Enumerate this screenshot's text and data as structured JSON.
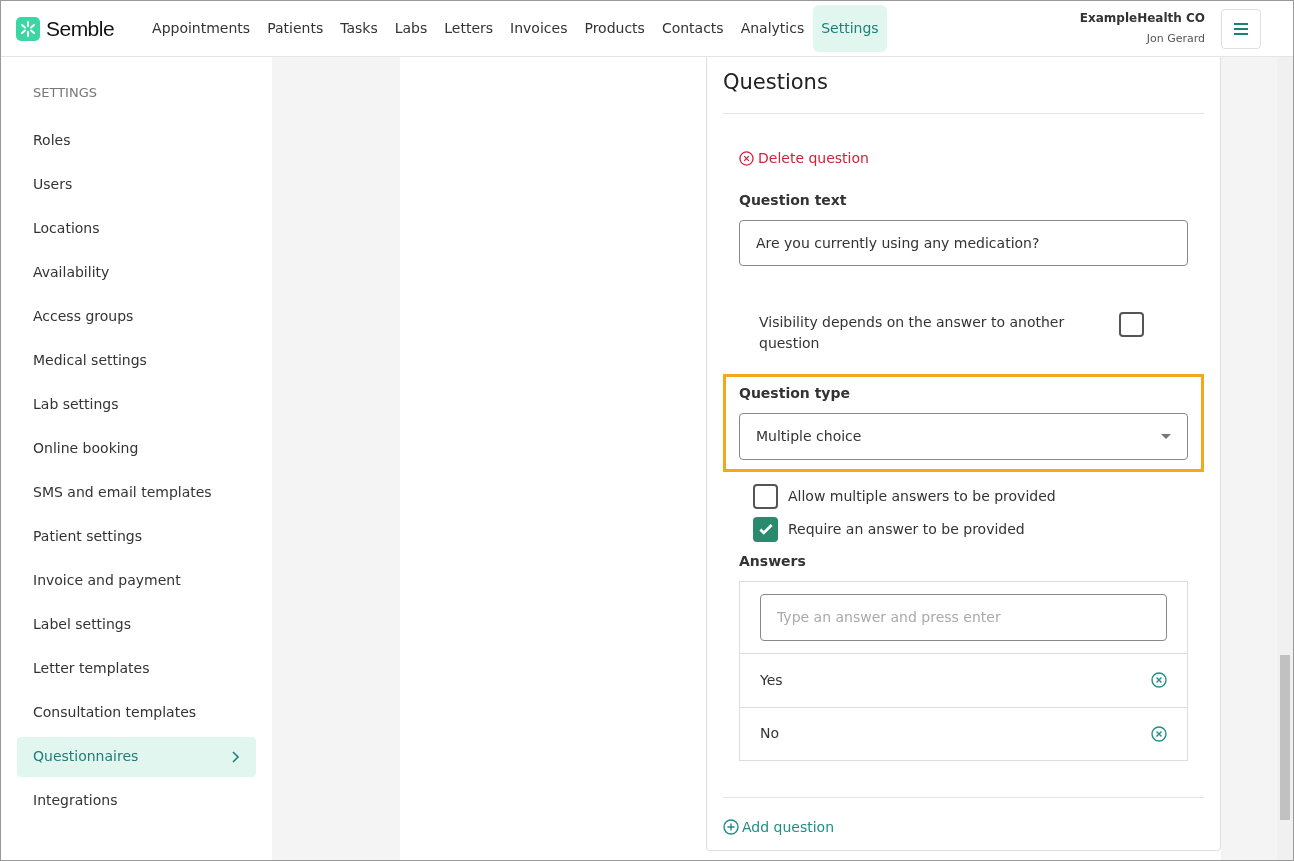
{
  "brand": {
    "name": "Semble"
  },
  "nav": [
    {
      "label": "Appointments",
      "selected": false
    },
    {
      "label": "Patients",
      "selected": false
    },
    {
      "label": "Tasks",
      "selected": false
    },
    {
      "label": "Labs",
      "selected": false
    },
    {
      "label": "Letters",
      "selected": false
    },
    {
      "label": "Invoices",
      "selected": false
    },
    {
      "label": "Products",
      "selected": false
    },
    {
      "label": "Contacts",
      "selected": false
    },
    {
      "label": "Analytics",
      "selected": false
    },
    {
      "label": "Settings",
      "selected": true
    }
  ],
  "account": {
    "organisation": "ExampleHealth CO",
    "user": "Jon Gerard"
  },
  "sidebar": {
    "heading": "SETTINGS",
    "items": [
      {
        "label": "Roles",
        "selected": false
      },
      {
        "label": "Users",
        "selected": false
      },
      {
        "label": "Locations",
        "selected": false
      },
      {
        "label": "Availability",
        "selected": false
      },
      {
        "label": "Access groups",
        "selected": false
      },
      {
        "label": "Medical settings",
        "selected": false
      },
      {
        "label": "Lab settings",
        "selected": false
      },
      {
        "label": "Online booking",
        "selected": false
      },
      {
        "label": "SMS and email templates",
        "selected": false
      },
      {
        "label": "Patient settings",
        "selected": false
      },
      {
        "label": "Invoice and payment",
        "selected": false
      },
      {
        "label": "Label settings",
        "selected": false
      },
      {
        "label": "Letter templates",
        "selected": false
      },
      {
        "label": "Consultation templates",
        "selected": false
      },
      {
        "label": "Questionnaires",
        "selected": true
      },
      {
        "label": "Integrations",
        "selected": false
      }
    ]
  },
  "questions": {
    "title": "Questions",
    "delete_label": "Delete question",
    "question_text": {
      "label": "Question text",
      "value": "Are you currently using any medication?"
    },
    "visibility": {
      "label": "Visibility depends on the answer to another question",
      "checked": false
    },
    "question_type": {
      "label": "Question type",
      "value": "Multiple choice",
      "highlighted": true
    },
    "options": [
      {
        "label": "Allow multiple answers to be provided",
        "checked": false
      },
      {
        "label": "Require an answer to be provided",
        "checked": true
      }
    ],
    "answers": {
      "label": "Answers",
      "placeholder": "Type an answer and press enter",
      "items": [
        "Yes",
        "No"
      ]
    },
    "add_label": "Add question"
  }
}
